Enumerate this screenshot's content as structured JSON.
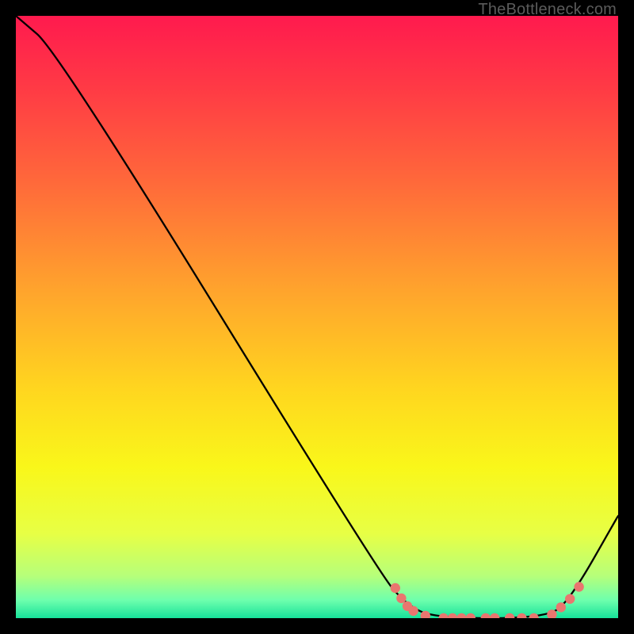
{
  "watermark": "TheBottleneck.com",
  "chart_data": {
    "type": "line",
    "title": "",
    "xlabel": "",
    "ylabel": "",
    "xlim": [
      0,
      100
    ],
    "ylim": [
      0,
      100
    ],
    "curve": [
      {
        "x": 0,
        "y": 100
      },
      {
        "x": 7,
        "y": 94
      },
      {
        "x": 60,
        "y": 8
      },
      {
        "x": 65,
        "y": 2
      },
      {
        "x": 70,
        "y": 0
      },
      {
        "x": 88,
        "y": 0
      },
      {
        "x": 92,
        "y": 3
      },
      {
        "x": 100,
        "y": 17
      }
    ],
    "markers": [
      {
        "x": 63,
        "y": 5.0
      },
      {
        "x": 64,
        "y": 3.3
      },
      {
        "x": 65,
        "y": 2.0
      },
      {
        "x": 66,
        "y": 1.2
      },
      {
        "x": 68,
        "y": 0.4
      },
      {
        "x": 71,
        "y": 0
      },
      {
        "x": 72.5,
        "y": 0
      },
      {
        "x": 74,
        "y": 0
      },
      {
        "x": 75.5,
        "y": 0
      },
      {
        "x": 78,
        "y": 0
      },
      {
        "x": 79.5,
        "y": 0
      },
      {
        "x": 82,
        "y": 0
      },
      {
        "x": 84,
        "y": 0
      },
      {
        "x": 86,
        "y": 0
      },
      {
        "x": 89,
        "y": 0.6
      },
      {
        "x": 90.5,
        "y": 1.8
      },
      {
        "x": 92,
        "y": 3.2
      },
      {
        "x": 93.5,
        "y": 5.2
      }
    ],
    "marker_color": "#e9766f",
    "curve_color": "#000000",
    "gradient_stops": [
      {
        "offset": 0.0,
        "color": "#ff1a4e"
      },
      {
        "offset": 0.12,
        "color": "#ff3a45"
      },
      {
        "offset": 0.28,
        "color": "#ff6a3a"
      },
      {
        "offset": 0.45,
        "color": "#ffa22d"
      },
      {
        "offset": 0.62,
        "color": "#ffd61f"
      },
      {
        "offset": 0.75,
        "color": "#f9f71a"
      },
      {
        "offset": 0.86,
        "color": "#e7ff45"
      },
      {
        "offset": 0.93,
        "color": "#b6ff7a"
      },
      {
        "offset": 0.97,
        "color": "#6effad"
      },
      {
        "offset": 1.0,
        "color": "#17e29a"
      }
    ]
  }
}
